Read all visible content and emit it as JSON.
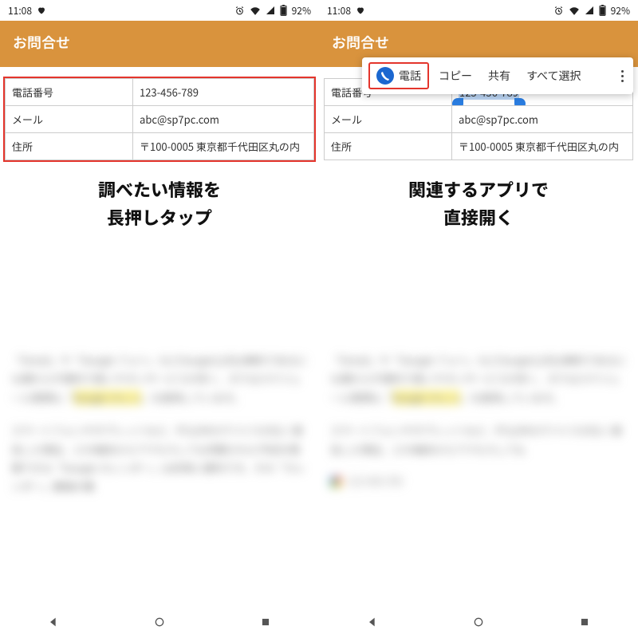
{
  "status": {
    "time": "11:08",
    "battery": "92%"
  },
  "header": {
    "title": "お問合せ"
  },
  "rows": [
    {
      "label": "電話番号",
      "value": "123-456-789"
    },
    {
      "label": "メール",
      "value": "abc@sp7pc.com"
    },
    {
      "label": "住所",
      "value": "〒100-0005 東京都千代田区丸の内"
    }
  ],
  "captions": {
    "left_l1": "調べたい情報を",
    "left_l2": "長押しタップ",
    "right_l1": "関連するアプリで",
    "right_l2": "直接開く"
  },
  "context_menu": {
    "call": "電話",
    "copy": "コピー",
    "share": "共有",
    "select_all": "すべて選択"
  },
  "suggest_text": "123-456-789"
}
